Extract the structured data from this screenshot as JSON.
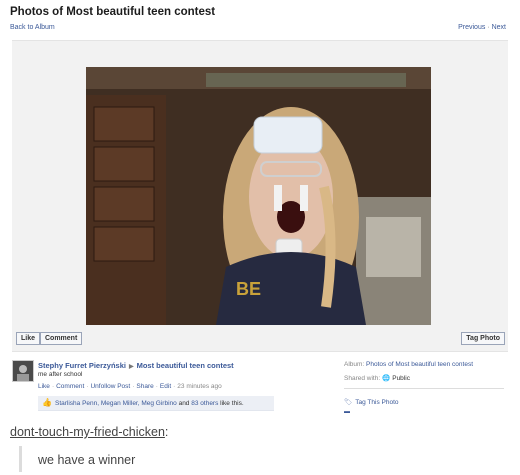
{
  "header": {
    "title": "Photos of Most beautiful teen contest",
    "back_link": "Back to Album",
    "previous_link": "Previous",
    "separator": "·",
    "next_link": "Next"
  },
  "photo": {
    "buttons": {
      "like": "Like",
      "comment": "Comment",
      "tag": "Tag Photo"
    },
    "overlay_text": "BE"
  },
  "post": {
    "owner": "Stephy Furret Pierzyński",
    "album_name": "Most beautiful teen contest",
    "caption": "me after school",
    "actions": [
      "Like",
      "Comment",
      "Unfollow Post",
      "Share",
      "Edit"
    ],
    "time": "23 minutes ago",
    "likes_names": "Starlisha Penn, Megan Miller, Meg Girbino",
    "likes_and": "and",
    "likes_others": "83 others",
    "likes_suffix": "like this."
  },
  "sidebar": {
    "album_label": "Album:",
    "album_link": "Photos of Most beautiful teen contest",
    "shared_label": "Shared with:",
    "shared_value": "Public",
    "tag_this": "Tag This Photo"
  },
  "tumblr": {
    "username": "dont-touch-my-fried-chicken",
    "colon": ":",
    "quote": "we have a winner"
  }
}
